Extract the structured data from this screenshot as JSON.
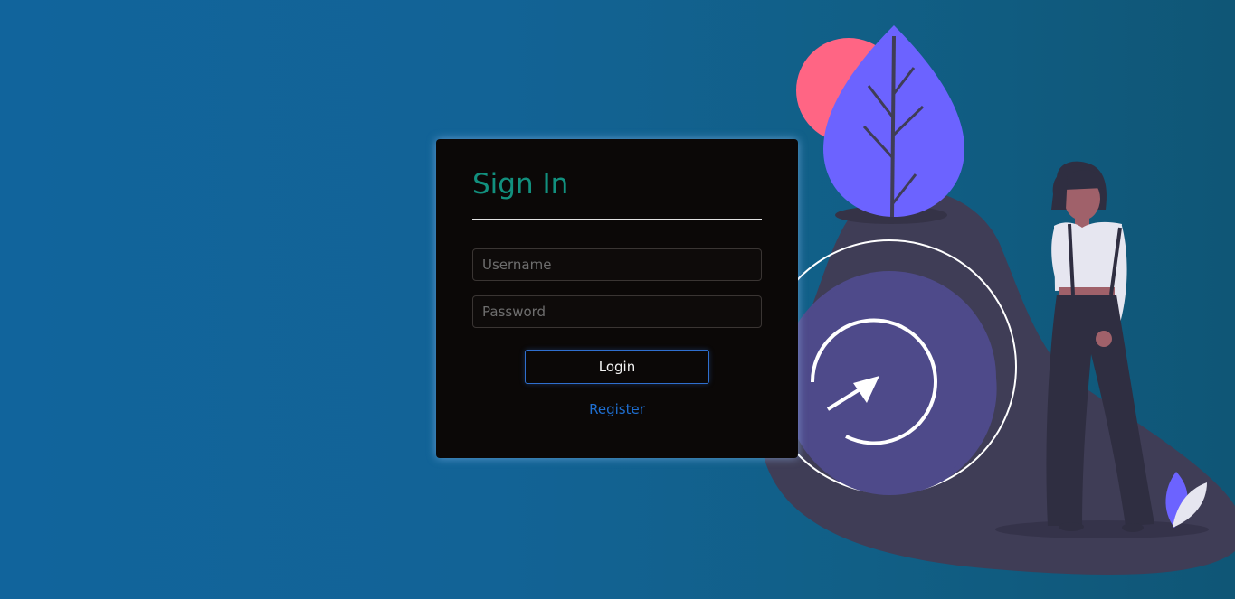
{
  "signin": {
    "title": "Sign In",
    "username": {
      "placeholder": "Username",
      "value": ""
    },
    "password": {
      "placeholder": "Password",
      "value": ""
    },
    "login_label": "Login",
    "register_label": "Register"
  },
  "colors": {
    "background_start": "#11649c",
    "background_end": "#0f5676",
    "card_background": "#0b0807",
    "title_color": "#12907e",
    "button_border": "#2f6fce",
    "link_color": "#1f6fd1",
    "illustration_accent": "#6c63ff",
    "illustration_pink": "#ff6584",
    "illustration_dark": "#3f3d56"
  },
  "illustration": {
    "icons": [
      "leaf-icon",
      "sun-circle",
      "refresh-arrow-icon",
      "woman-figure",
      "small-leaf-icon"
    ]
  }
}
